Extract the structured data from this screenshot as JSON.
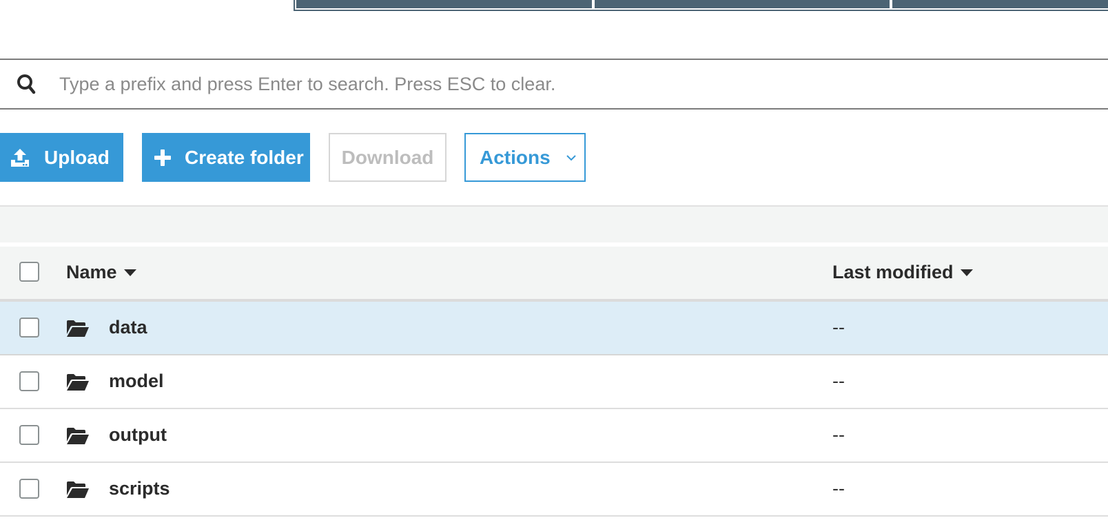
{
  "search": {
    "placeholder": "Type a prefix and press Enter to search. Press ESC to clear.",
    "value": "",
    "icon": "search-icon"
  },
  "toolbar": {
    "upload_label": "Upload",
    "create_folder_label": "Create folder",
    "download_label": "Download",
    "actions_label": "Actions",
    "primary_color": "#3699d7",
    "disabled_color": "#bdbdbd"
  },
  "table": {
    "columns": [
      {
        "label": "Name",
        "sort_icon": "caret-down-icon"
      },
      {
        "label": "Last modified",
        "sort_icon": "caret-down-icon"
      }
    ],
    "rows": [
      {
        "name": "data",
        "last_modified": "--",
        "type": "folder",
        "highlighted": true
      },
      {
        "name": "model",
        "last_modified": "--",
        "type": "folder",
        "highlighted": false
      },
      {
        "name": "output",
        "last_modified": "--",
        "type": "folder",
        "highlighted": false
      },
      {
        "name": "scripts",
        "last_modified": "--",
        "type": "folder",
        "highlighted": false
      }
    ],
    "highlight_color": "#ddedf7"
  }
}
